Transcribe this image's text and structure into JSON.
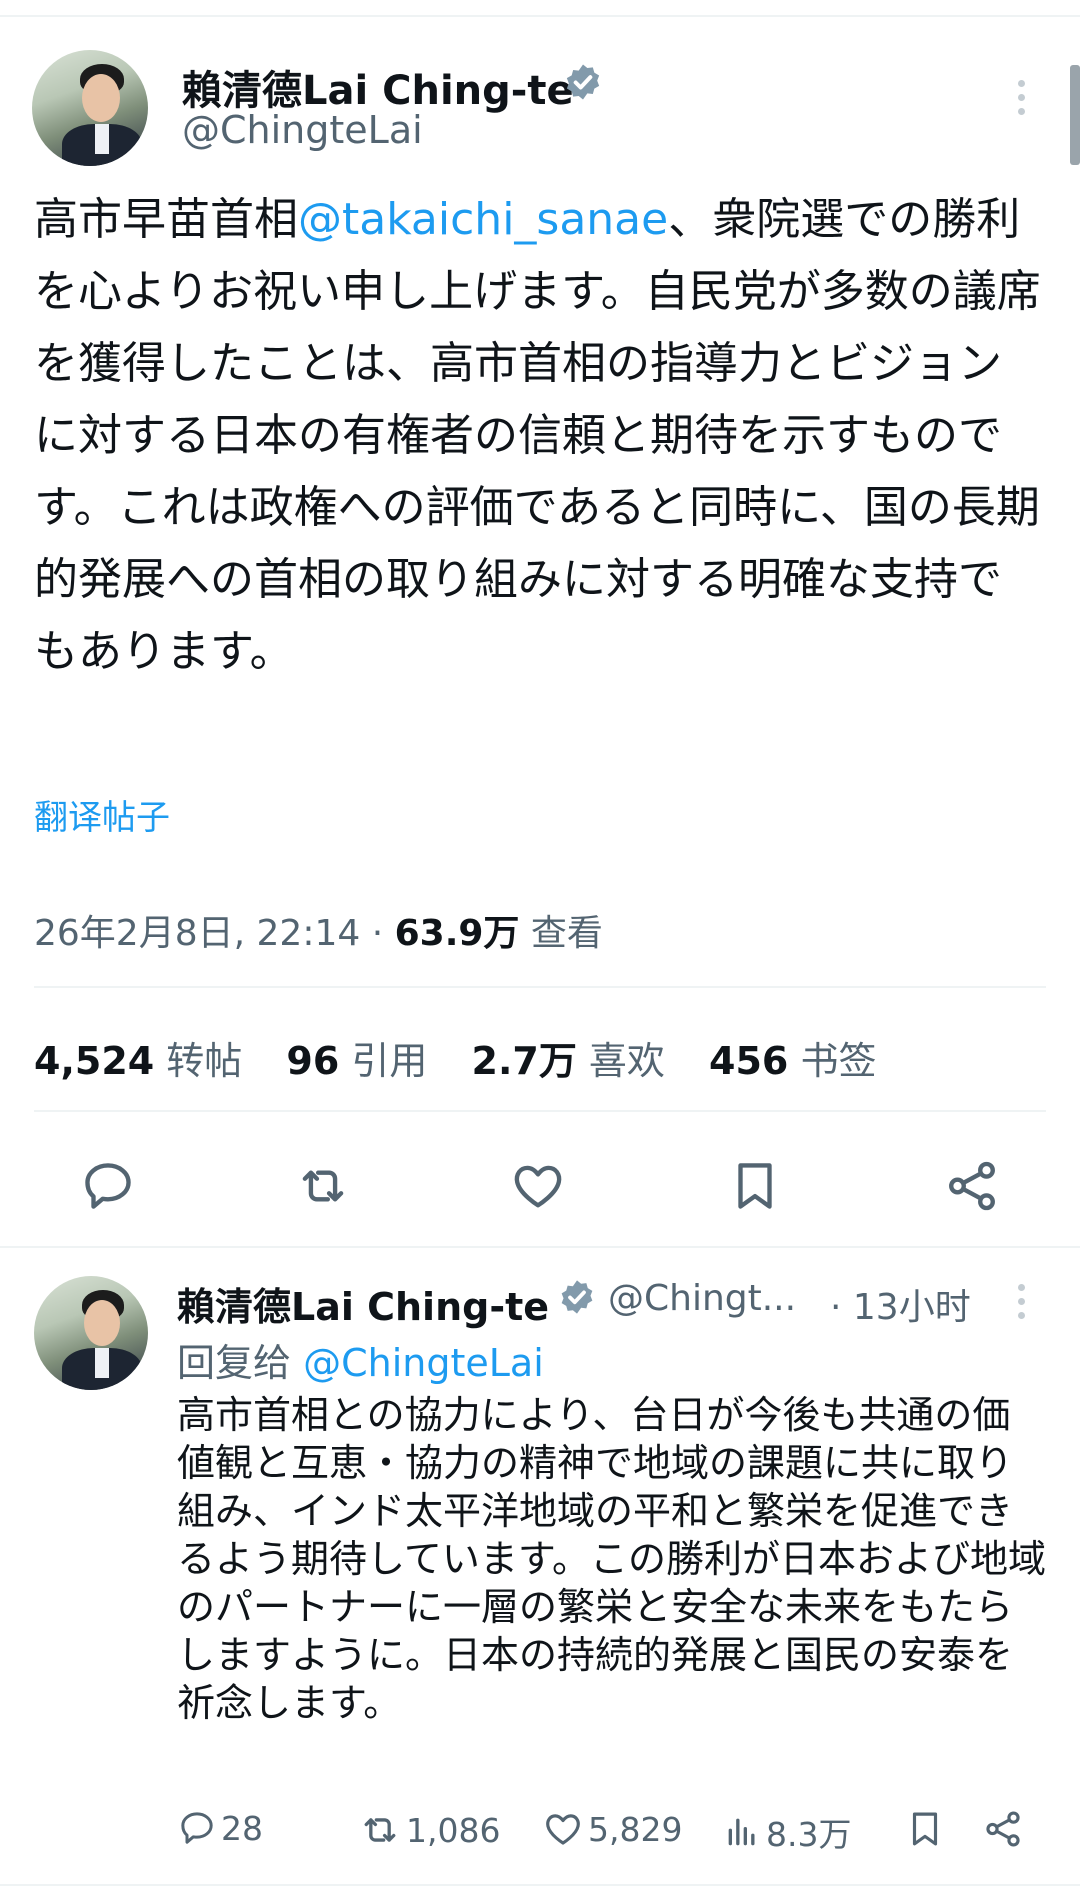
{
  "main_tweet": {
    "author_name": "賴清德Lai Ching-te",
    "author_handle": "@ChingteLai",
    "text_prefix": "高市早苗首相",
    "mention": "@takaichi_sanae",
    "text_suffix": "、衆院選での勝利を心よりお祝い申し上げます。自民党が多数の議席を獲得したことは、高市首相の指導力とビジョンに対する日本の有権者の信頼と期待を示すものです。これは政権への評価であると同時に、国の長期的発展への首相の取り組みに対する明確な支持でもあります。",
    "translate_label": "翻译帖子",
    "timestamp": "26年2月8日, 22:14",
    "separator": " · ",
    "views_count": "63.9万",
    "views_label": " 查看",
    "stats": {
      "retweets_count": "4,524",
      "retweets_label": "转帖",
      "quotes_count": "96",
      "quotes_label": "引用",
      "likes_count": "2.7万",
      "likes_label": "喜欢",
      "bookmarks_count": "456",
      "bookmarks_label": "书签"
    },
    "action_icons": [
      "reply-icon",
      "retweet-icon",
      "like-icon",
      "bookmark-icon",
      "share-icon"
    ]
  },
  "reply_tweet": {
    "author_name": "賴清德Lai Ching-te",
    "author_handle": "@Chingt...",
    "time": "· 13小时",
    "replying_to_label": "回复给 ",
    "replying_to_handle": "@ChingteLai",
    "text": "高市首相との協力により、台日が今後も共通の価値観と互恵・協力の精神で地域の課題に共に取り組み、インド太平洋地域の平和と繁栄を促進できるよう期待しています。この勝利が日本および地域のパートナーに一層の繁栄と安全な未来をもたらしますように。日本の持続的発展と国民の安泰を祈念します。",
    "replies": "28",
    "retweets": "1,086",
    "likes": "5,829",
    "views": "8.3万"
  },
  "colors": {
    "accent": "#1d9bf0",
    "verified_badge": "#829aab",
    "secondary_text": "#536471",
    "divider": "#eff3f4"
  }
}
